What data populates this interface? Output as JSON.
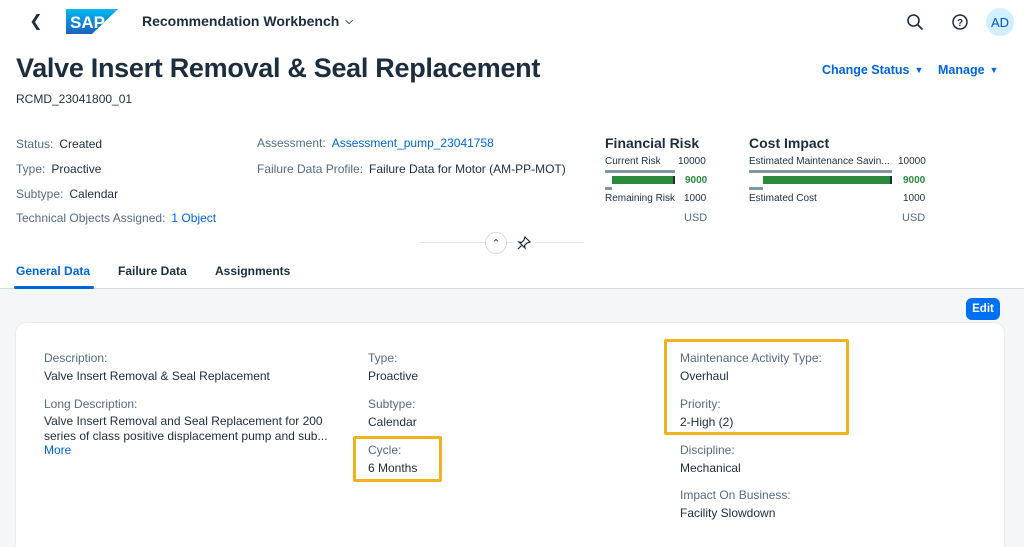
{
  "shell": {
    "app_title": "Recommendation Workbench",
    "logo_text": "SAP",
    "avatar_initials": "AD",
    "icons": [
      "back-icon",
      "search-icon",
      "help-icon"
    ]
  },
  "header": {
    "title": "Valve Insert Removal & Seal Replacement",
    "id": "RCMD_23041800_01",
    "actions": {
      "change_status": "Change Status",
      "manage": "Manage"
    },
    "attributes": {
      "status_label": "Status:",
      "status_value": "Created",
      "type_label": "Type:",
      "type_value": "Proactive",
      "subtype_label": "Subtype:",
      "subtype_value": "Calendar",
      "tech_label": "Technical Objects Assigned:",
      "tech_value": "1 Object",
      "assessment_label": "Assessment:",
      "assessment_value": "Assessment_pump_23041758",
      "fdp_label": "Failure Data Profile:",
      "fdp_value": "Failure Data for Motor (AM-PP-MOT)"
    },
    "financial_risk": {
      "title": "Financial Risk",
      "current_label": "Current Risk",
      "current_value": "10000",
      "bar_value": "9000",
      "remaining_label": "Remaining Risk",
      "remaining_value": "1000",
      "currency": "USD",
      "difference_fraction": 0.9
    },
    "cost_impact": {
      "title": "Cost Impact",
      "savings_label": "Estimated Maintenance Savin...",
      "savings_value": "10000",
      "bar_value": "9000",
      "cost_label": "Estimated Cost",
      "cost_value": "1000",
      "currency": "USD",
      "difference_fraction": 0.9
    }
  },
  "tabs": [
    {
      "label": "General Data",
      "active": true
    },
    {
      "label": "Failure Data",
      "active": false
    },
    {
      "label": "Assignments",
      "active": false
    }
  ],
  "general": {
    "edit_label": "Edit",
    "description_label": "Description:",
    "description_value": "Valve Insert Removal & Seal Replacement",
    "long_label": "Long Description:",
    "long_value": "Valve Insert Removal and Seal Replacement for 200 series of class positive displacement pump and sub...",
    "more_label": "More",
    "type_label": "Type:",
    "type_value": "Proactive",
    "subtype_label": "Subtype:",
    "subtype_value": "Calendar",
    "cycle_label": "Cycle:",
    "cycle_value": "6 Months",
    "mat_label": "Maintenance Activity Type:",
    "mat_value": "Overhaul",
    "priority_label": "Priority:",
    "priority_value": "2-High (2)",
    "discipline_label": "Discipline:",
    "discipline_value": "Mechanical",
    "impact_label": "Impact On Business:",
    "impact_value": "Facility Slowdown"
  },
  "colors": {
    "accent": "#0064d9",
    "highlight": "#f0b21e",
    "positive": "#2b8a3e"
  }
}
